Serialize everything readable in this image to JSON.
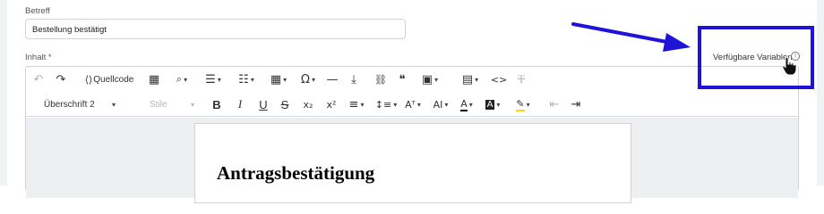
{
  "form": {
    "subject_label": "Betreff",
    "subject_value": "Bestellung bestätigt",
    "content_label": "Inhalt",
    "required_mark": "*"
  },
  "variables_link": {
    "label": "Verfügbare Variablen",
    "icon": "info-icon"
  },
  "toolbar": {
    "row1": [
      {
        "name": "undo-icon",
        "glyph": "↶"
      },
      {
        "name": "redo-icon",
        "glyph": "↷"
      },
      {
        "name": "source-code-icon",
        "glyph": "⟨⟩"
      },
      {
        "name": "source-code-label",
        "text": "Quellcode"
      },
      {
        "name": "select-all-icon",
        "glyph": "▦"
      },
      {
        "name": "find-replace-icon",
        "glyph": "🔍"
      },
      {
        "name": "bulleted-list-icon",
        "glyph": "☰"
      },
      {
        "name": "numbered-list-icon",
        "glyph": "☷"
      },
      {
        "name": "table-icon",
        "glyph": "▦"
      },
      {
        "name": "special-characters-icon",
        "glyph": "Ω"
      },
      {
        "name": "horizontal-line-icon",
        "glyph": "—"
      },
      {
        "name": "page-break-icon",
        "glyph": "⤓"
      },
      {
        "name": "link-icon",
        "glyph": "🔗"
      },
      {
        "name": "quote-icon",
        "glyph": "❝"
      },
      {
        "name": "image-icon",
        "glyph": "▣"
      },
      {
        "name": "insert-template-icon",
        "glyph": "▤"
      },
      {
        "name": "html-embed-icon",
        "glyph": "<>"
      },
      {
        "name": "remove-format-icon",
        "glyph": "T"
      }
    ],
    "heading_select": "Überschrift 2",
    "style_select": "Stile",
    "row2": [
      {
        "name": "bold-icon",
        "glyph": "B"
      },
      {
        "name": "italic-icon",
        "glyph": "I"
      },
      {
        "name": "underline-icon",
        "glyph": "U"
      },
      {
        "name": "strikethrough-icon",
        "glyph": "S"
      },
      {
        "name": "subscript-icon",
        "glyph": "x₂"
      },
      {
        "name": "superscript-icon",
        "glyph": "x²"
      },
      {
        "name": "alignment-icon",
        "glyph": "≡"
      },
      {
        "name": "line-height-icon",
        "glyph": "↕≡"
      },
      {
        "name": "font-size-icon",
        "glyph": "Aᵀ"
      },
      {
        "name": "font-family-icon",
        "glyph": "AI"
      },
      {
        "name": "font-color-icon",
        "glyph": "A"
      },
      {
        "name": "font-background-icon",
        "glyph": "A"
      },
      {
        "name": "highlight-icon",
        "glyph": "✎"
      },
      {
        "name": "outdent-icon",
        "glyph": "⇤"
      },
      {
        "name": "indent-icon",
        "glyph": "⇥"
      }
    ]
  },
  "document": {
    "heading": "Antragsbestätigung"
  },
  "colors": {
    "annotation": "#1f13d8",
    "required": "#d32f2f",
    "font_color_underline": "#000000",
    "highlight_underline": "#f5d90a"
  }
}
